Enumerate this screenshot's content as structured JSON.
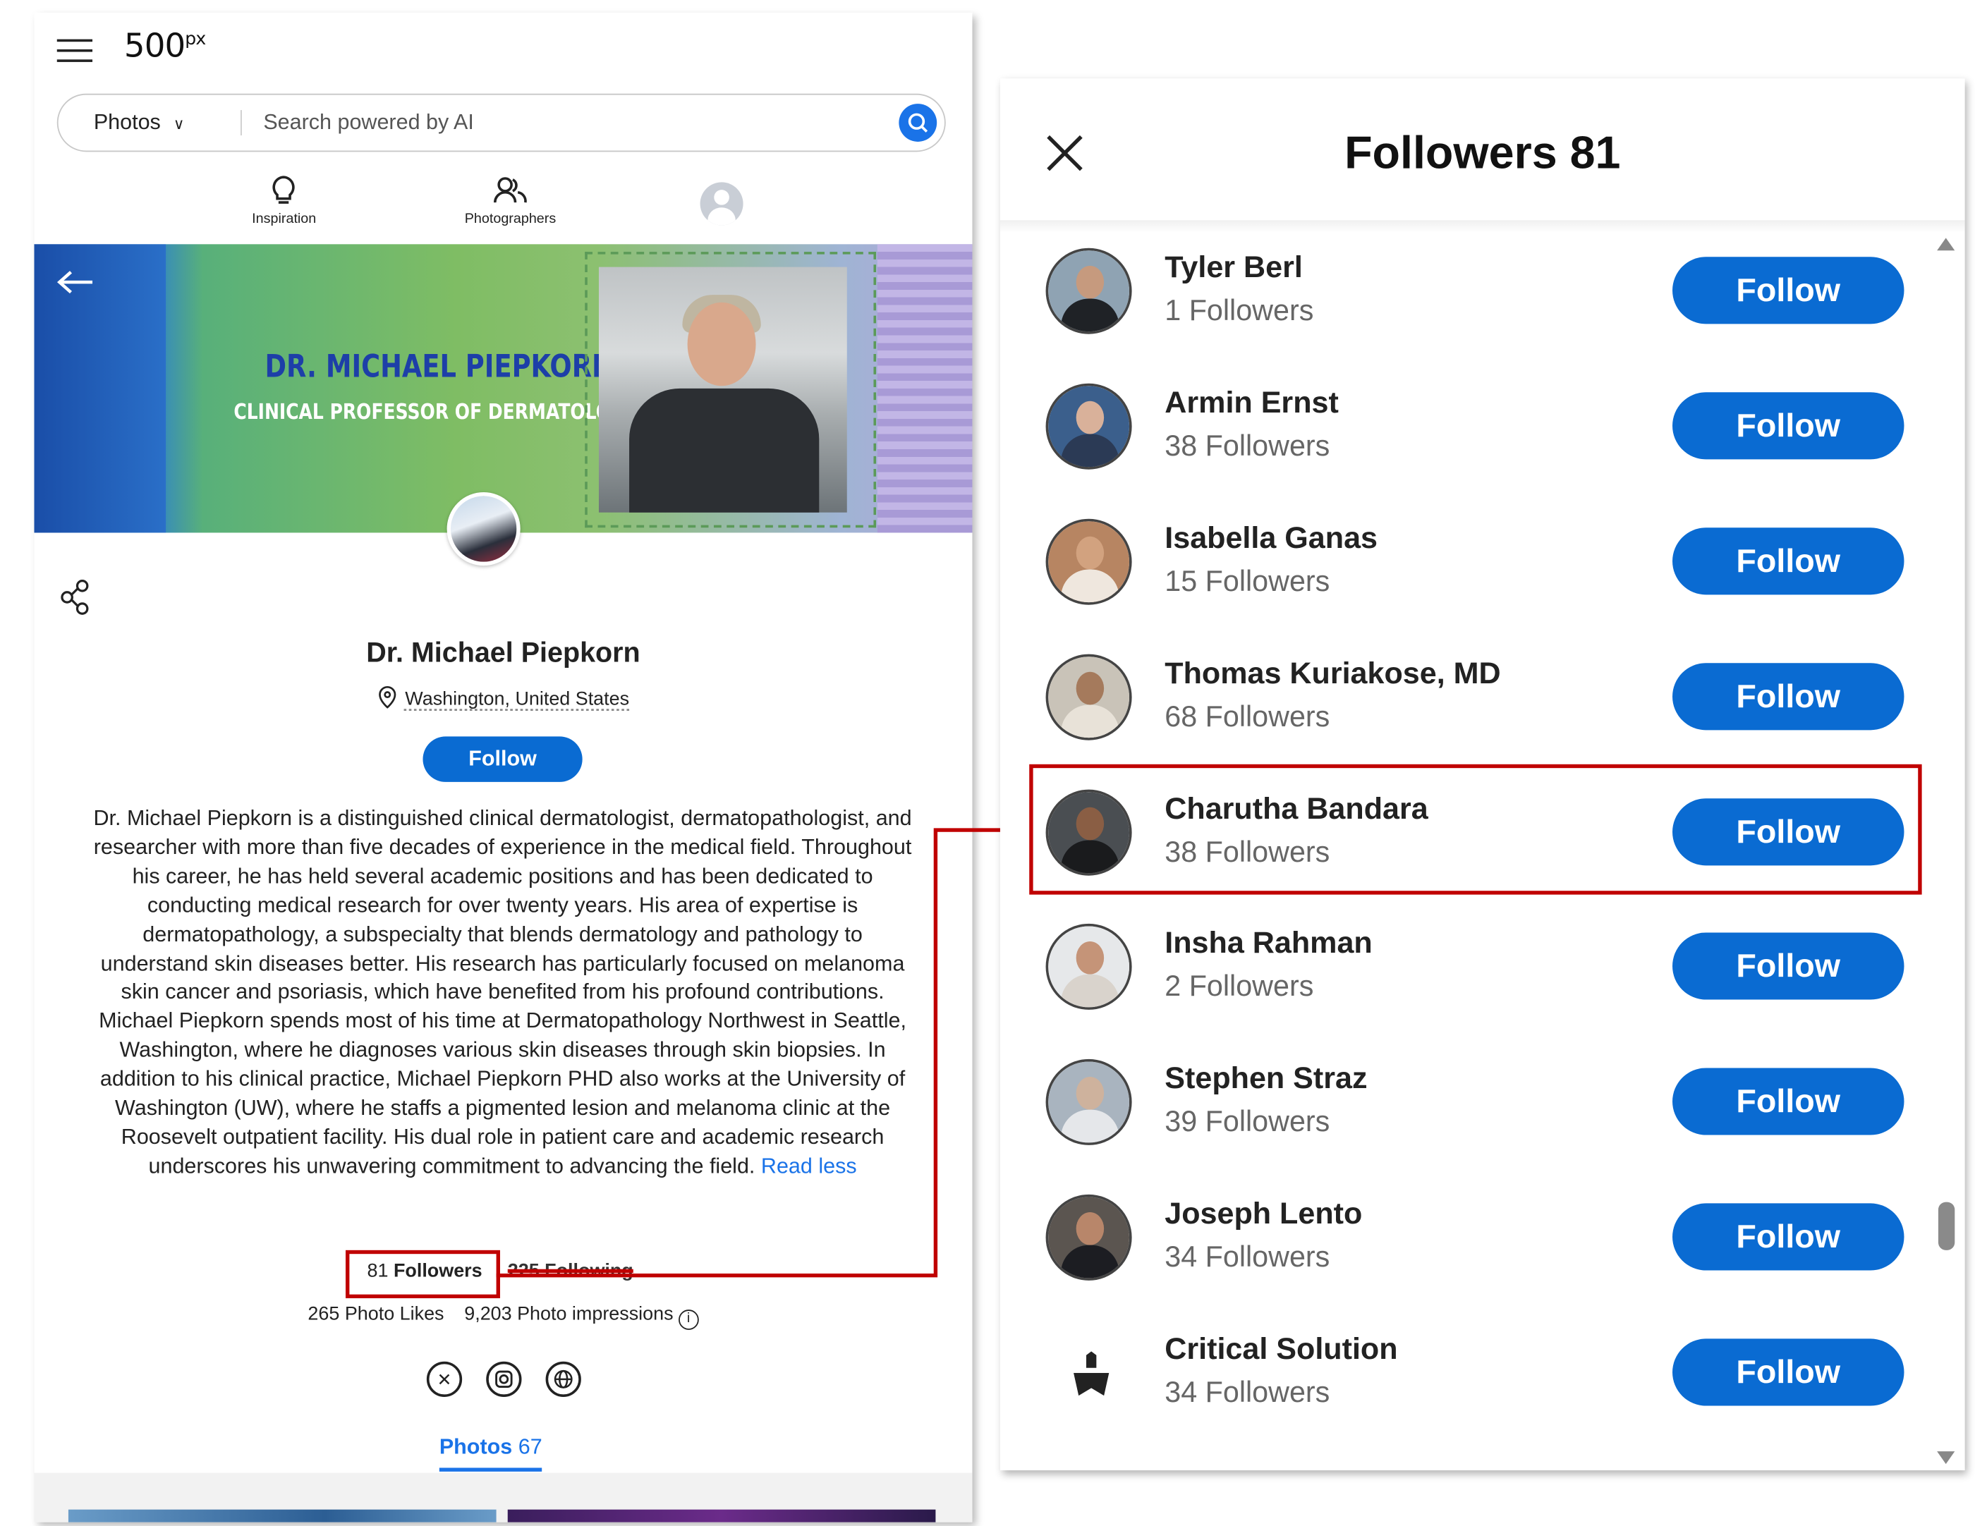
{
  "header": {
    "logo_text": "500",
    "logo_sup": "px",
    "search": {
      "category": "Photos",
      "placeholder": "Search powered by AI"
    },
    "nav": {
      "inspiration": "Inspiration",
      "photographers": "Photographers"
    }
  },
  "banner": {
    "title": "DR. MICHAEL PIEPKORN",
    "subtitle": "CLINICAL PROFESSOR OF DERMATOLOGY"
  },
  "profile": {
    "name": "Dr. Michael Piepkorn",
    "location": "Washington, United States",
    "follow_label": "Follow",
    "bio": "Dr. Michael Piepkorn is a distinguished clinical dermatologist, dermatopathologist, and researcher with more than five decades of experience in the medical field. Throughout his career, he has held several academic positions and has been dedicated to conducting medical research for over twenty years. His area of expertise is dermatopathology, a subspecialty that blends dermatology and pathology to understand skin diseases better. His research has particularly focused on melanoma skin cancer and psoriasis, which have benefited from his profound contributions. Michael Piepkorn spends most of his time at Dermatopathology Northwest in Seattle, Washington, where he diagnoses various skin diseases through skin biopsies. In addition to his clinical practice, Michael Piepkorn PHD also works at the University of Washington (UW), where he staffs a pigmented lesion and melanoma clinic at the Roosevelt outpatient facility. His dual role in patient care and academic research underscores his unwavering commitment to advancing the field.",
    "read_less": "Read less",
    "followers_count": "81",
    "followers_label": "Followers",
    "following_text": "225 Following",
    "photo_likes": "265 Photo Likes",
    "photo_impressions": "9,203 Photo impressions",
    "photos_tab_label": "Photos",
    "photos_tab_count": "67"
  },
  "followers_panel": {
    "title": "Followers 81",
    "follow_label": "Follow",
    "items": [
      {
        "name": "Tyler Berl",
        "count": "1 Followers"
      },
      {
        "name": "Armin Ernst",
        "count": "38 Followers"
      },
      {
        "name": "Isabella Ganas",
        "count": "15 Followers"
      },
      {
        "name": "Thomas Kuriakose, MD",
        "count": "68 Followers"
      },
      {
        "name": "Charutha Bandara",
        "count": "38 Followers"
      },
      {
        "name": "Insha Rahman",
        "count": "2 Followers"
      },
      {
        "name": "Stephen Straz",
        "count": "39 Followers"
      },
      {
        "name": "Joseph Lento",
        "count": "34 Followers"
      },
      {
        "name": "Critical Solution",
        "count": "34 Followers"
      }
    ]
  },
  "colors": {
    "brand_blue": "#0a6bd2",
    "highlight_red": "#c00000"
  },
  "icons": [
    "hamburger-icon",
    "chevron-down-icon",
    "search-icon",
    "lightbulb-icon",
    "people-icon",
    "back-arrow-icon",
    "share-icon",
    "location-pin-icon",
    "info-icon",
    "x-twitter-icon",
    "instagram-icon",
    "globe-icon",
    "close-icon"
  ]
}
